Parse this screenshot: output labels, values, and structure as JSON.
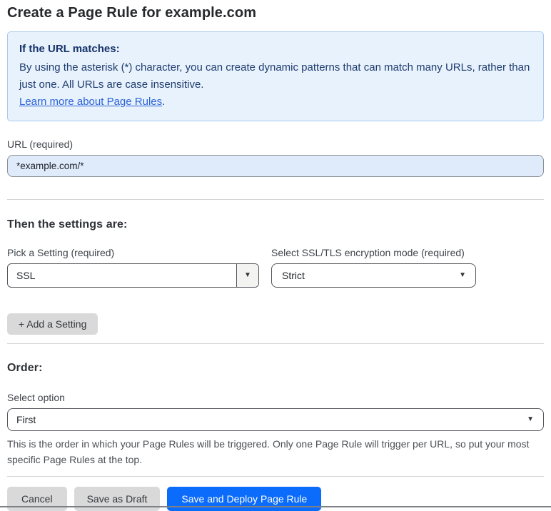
{
  "page": {
    "title": "Create a Page Rule for example.com"
  },
  "info_box": {
    "heading": "If the URL matches:",
    "body": "By using the asterisk (*) character, you can create dynamic patterns that can match many URLs, rather than just one. All URLs are case insensitive.",
    "link_label": "Learn more about Page Rules",
    "link_suffix": "."
  },
  "url_field": {
    "label": "URL (required)",
    "value": "*example.com/*"
  },
  "settings_section": {
    "heading": "Then the settings are:",
    "pick_setting": {
      "label": "Pick a Setting (required)",
      "value": "SSL"
    },
    "ssl_mode": {
      "label": "Select SSL/TLS encryption mode (required)",
      "value": "Strict"
    },
    "add_setting_label": "+ Add a Setting"
  },
  "order_section": {
    "heading": "Order:",
    "select_label": "Select option",
    "value": "First",
    "help_text": "This is the order in which your Page Rules will be triggered. Only one Page Rule will trigger per URL, so put your most specific Page Rules at the top."
  },
  "footer": {
    "cancel_label": "Cancel",
    "save_draft_label": "Save as Draft",
    "save_deploy_label": "Save and Deploy Page Rule"
  },
  "icons": {
    "dropdown_arrow": "▼"
  },
  "colors": {
    "accent_blue": "#0b6cfb",
    "info_box_bg": "#e8f2fc",
    "info_box_border": "#a9c9ee",
    "info_text_navy": "#1e3c6e",
    "link_blue": "#2b62d9",
    "url_input_bg": "#dfeafa",
    "gray_button_bg": "#d9d9d9",
    "divider_gray": "#d4d4d4",
    "select_border": "#54575d"
  }
}
